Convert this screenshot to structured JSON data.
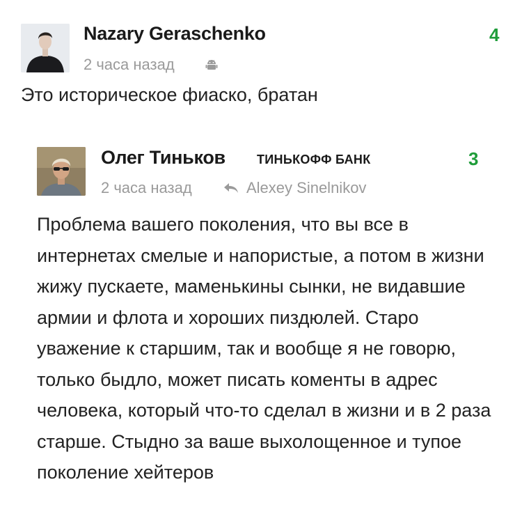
{
  "comment": {
    "author": "Nazary Geraschenko",
    "time": "2 часа назад",
    "device_icon": "android-icon",
    "score": "4",
    "text": "Это историческое фиаско, братан"
  },
  "reply": {
    "author": "Олег Тиньков",
    "badge": "ТИНЬКОФФ БАНК",
    "time": "2 часа назад",
    "reply_icon": "reply-arrow-icon",
    "reply_to": "Alexey Sinelnikov",
    "score": "3",
    "text": "Проблема вашего поколения, что вы все в интернетах смелые и напористые, а потом в жизни жижу пускаете, маменькины сынки, не видавшие армии и флота и хороших пиздюлей. Старо уважение к старшим, так и вообще я не говорю, только быдло, может писать коменты в адрес человека, который что-то сделал в жизни и в 2 раза старше. Стыдно за ваше выхолощенное и тупое поколение хейтеров"
  },
  "colors": {
    "score": "#1f9d3a",
    "meta": "#9a9a9a",
    "text": "#222222"
  }
}
